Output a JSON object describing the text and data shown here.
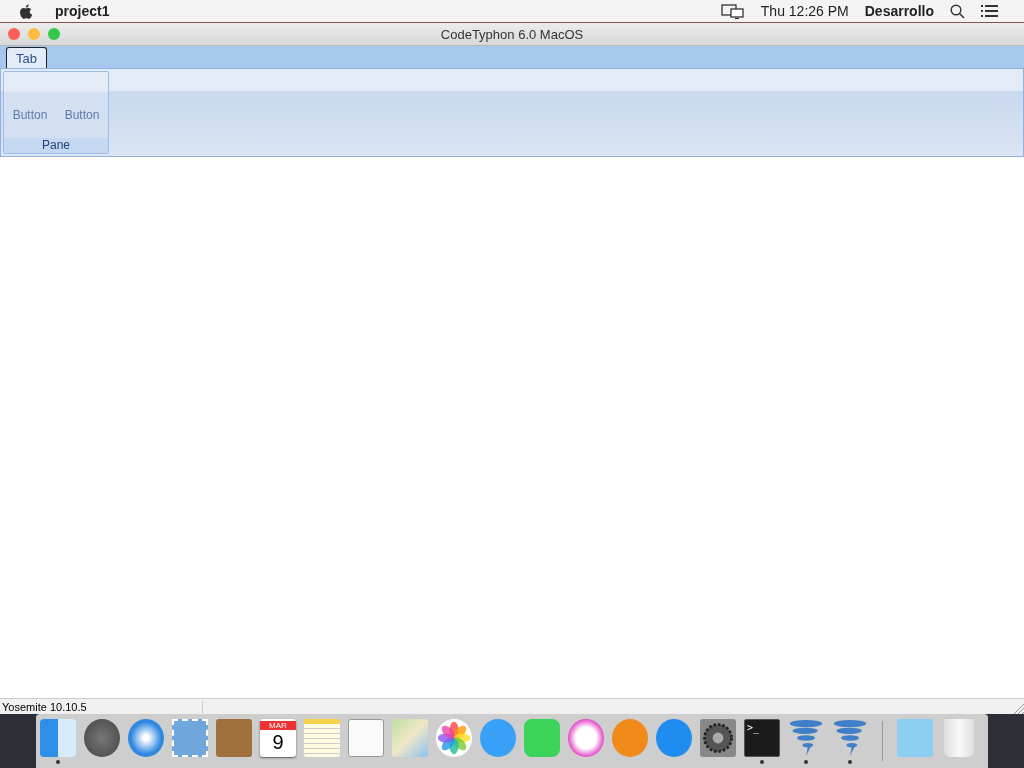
{
  "menu_bar": {
    "app_name": "project1",
    "clock": "Thu 12:26 PM",
    "user": "Desarrollo"
  },
  "window": {
    "title": "CodeTyphon 6.0 MacOS"
  },
  "tabs": [
    {
      "label": "Tab",
      "selected": true
    }
  ],
  "panes": [
    {
      "label": "Pane",
      "buttons": [
        "Button",
        "Button"
      ]
    }
  ],
  "status_bar": {
    "panels": [
      "Yosemite 10.10.5"
    ]
  },
  "dock": {
    "items": [
      {
        "kind": "finder",
        "running": true
      },
      {
        "kind": "launchpad",
        "running": false
      },
      {
        "kind": "safari",
        "running": false
      },
      {
        "kind": "mail",
        "running": false
      },
      {
        "kind": "contacts",
        "running": false
      },
      {
        "kind": "calendar",
        "running": false,
        "month": "MAR",
        "day": "9"
      },
      {
        "kind": "notes",
        "running": false
      },
      {
        "kind": "reminders",
        "running": false
      },
      {
        "kind": "maps",
        "running": false
      },
      {
        "kind": "photos",
        "running": false
      },
      {
        "kind": "messages",
        "running": false
      },
      {
        "kind": "facetime",
        "running": false
      },
      {
        "kind": "itunes",
        "running": false
      },
      {
        "kind": "ibooks",
        "running": false
      },
      {
        "kind": "appstore",
        "running": false
      },
      {
        "kind": "preferences",
        "running": false
      },
      {
        "kind": "terminal",
        "running": true,
        "prompt": ">_"
      },
      {
        "kind": "typhon",
        "running": true
      },
      {
        "kind": "typhon",
        "running": true
      },
      {
        "kind": "separator"
      },
      {
        "kind": "downloads",
        "running": false
      },
      {
        "kind": "trash",
        "running": false
      }
    ]
  }
}
